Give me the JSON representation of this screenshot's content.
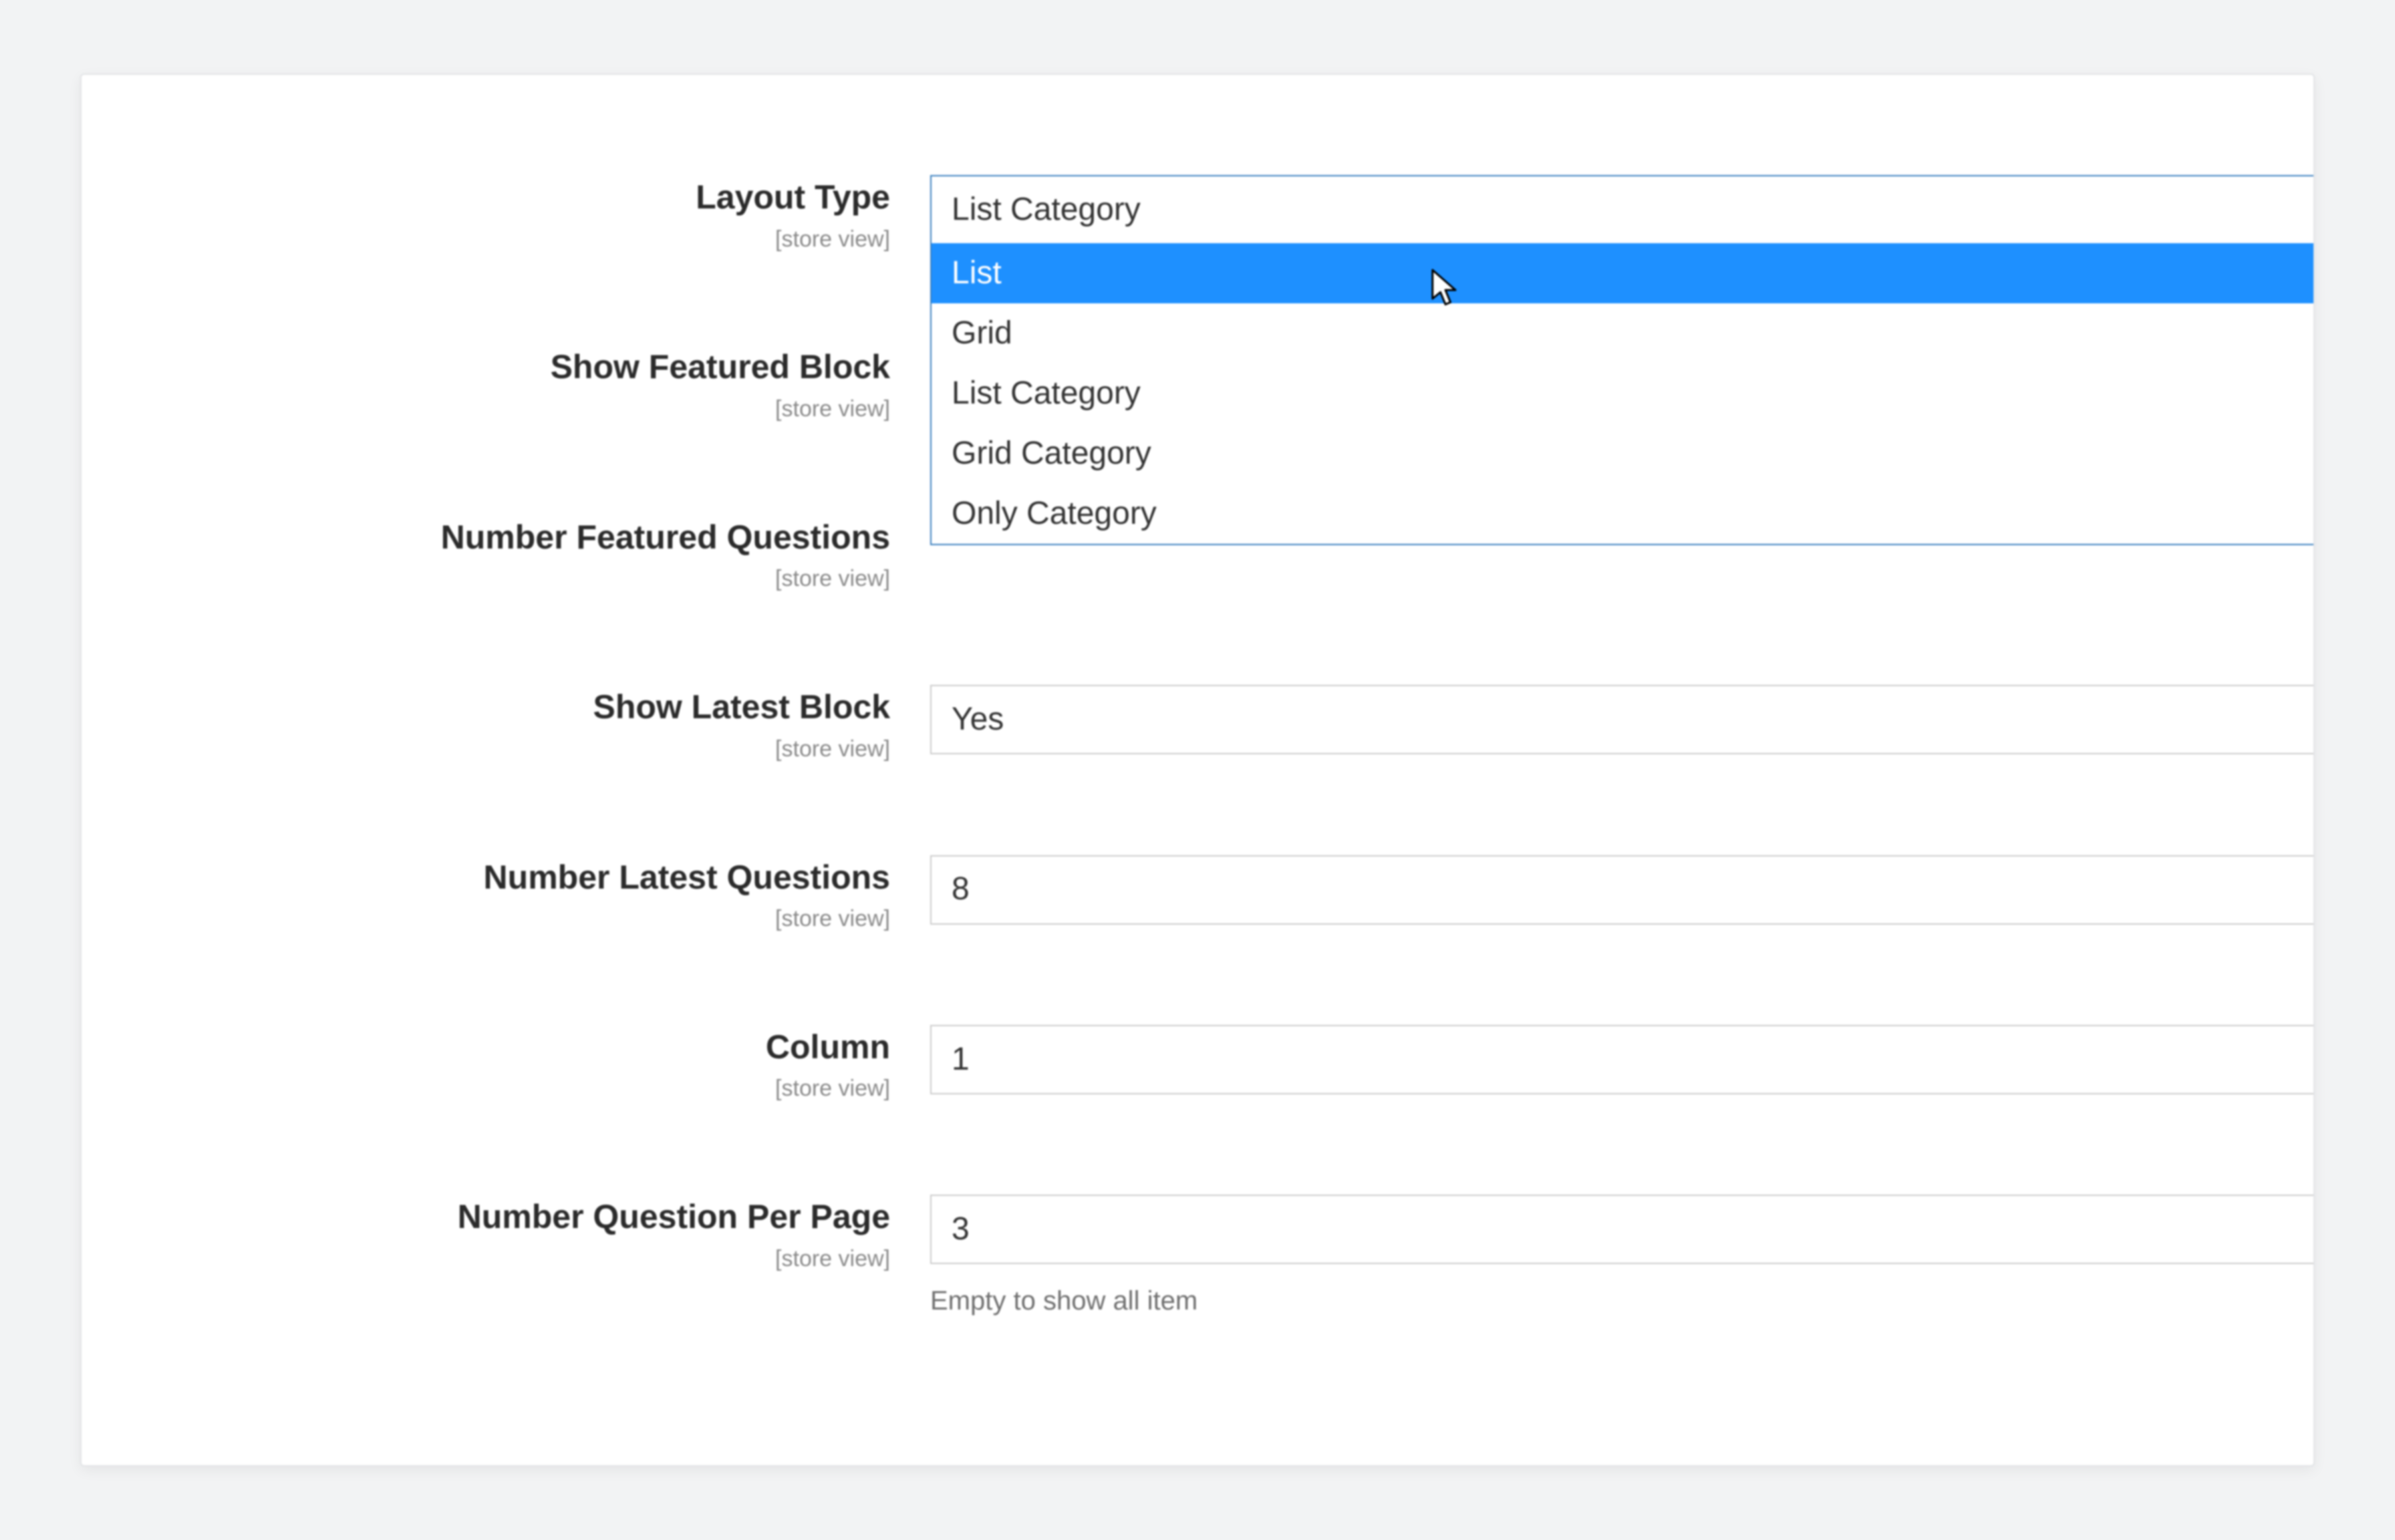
{
  "scope_text": "[store view]",
  "fields": {
    "layout_type": {
      "label": "Layout Type",
      "current": "List Category",
      "options": [
        "List",
        "Grid",
        "List Category",
        "Grid Category",
        "Only Category"
      ],
      "highlighted_option": "List"
    },
    "show_featured_block": {
      "label": "Show Featured Block"
    },
    "number_featured_questions": {
      "label": "Number Featured Questions"
    },
    "show_latest_block": {
      "label": "Show Latest Block",
      "value": "Yes"
    },
    "number_latest_questions": {
      "label": "Number Latest Questions",
      "value": "8"
    },
    "column": {
      "label": "Column",
      "value": "1"
    },
    "number_question_per_page": {
      "label": "Number Question Per Page",
      "value": "3",
      "hint": "Empty to show all item"
    }
  }
}
